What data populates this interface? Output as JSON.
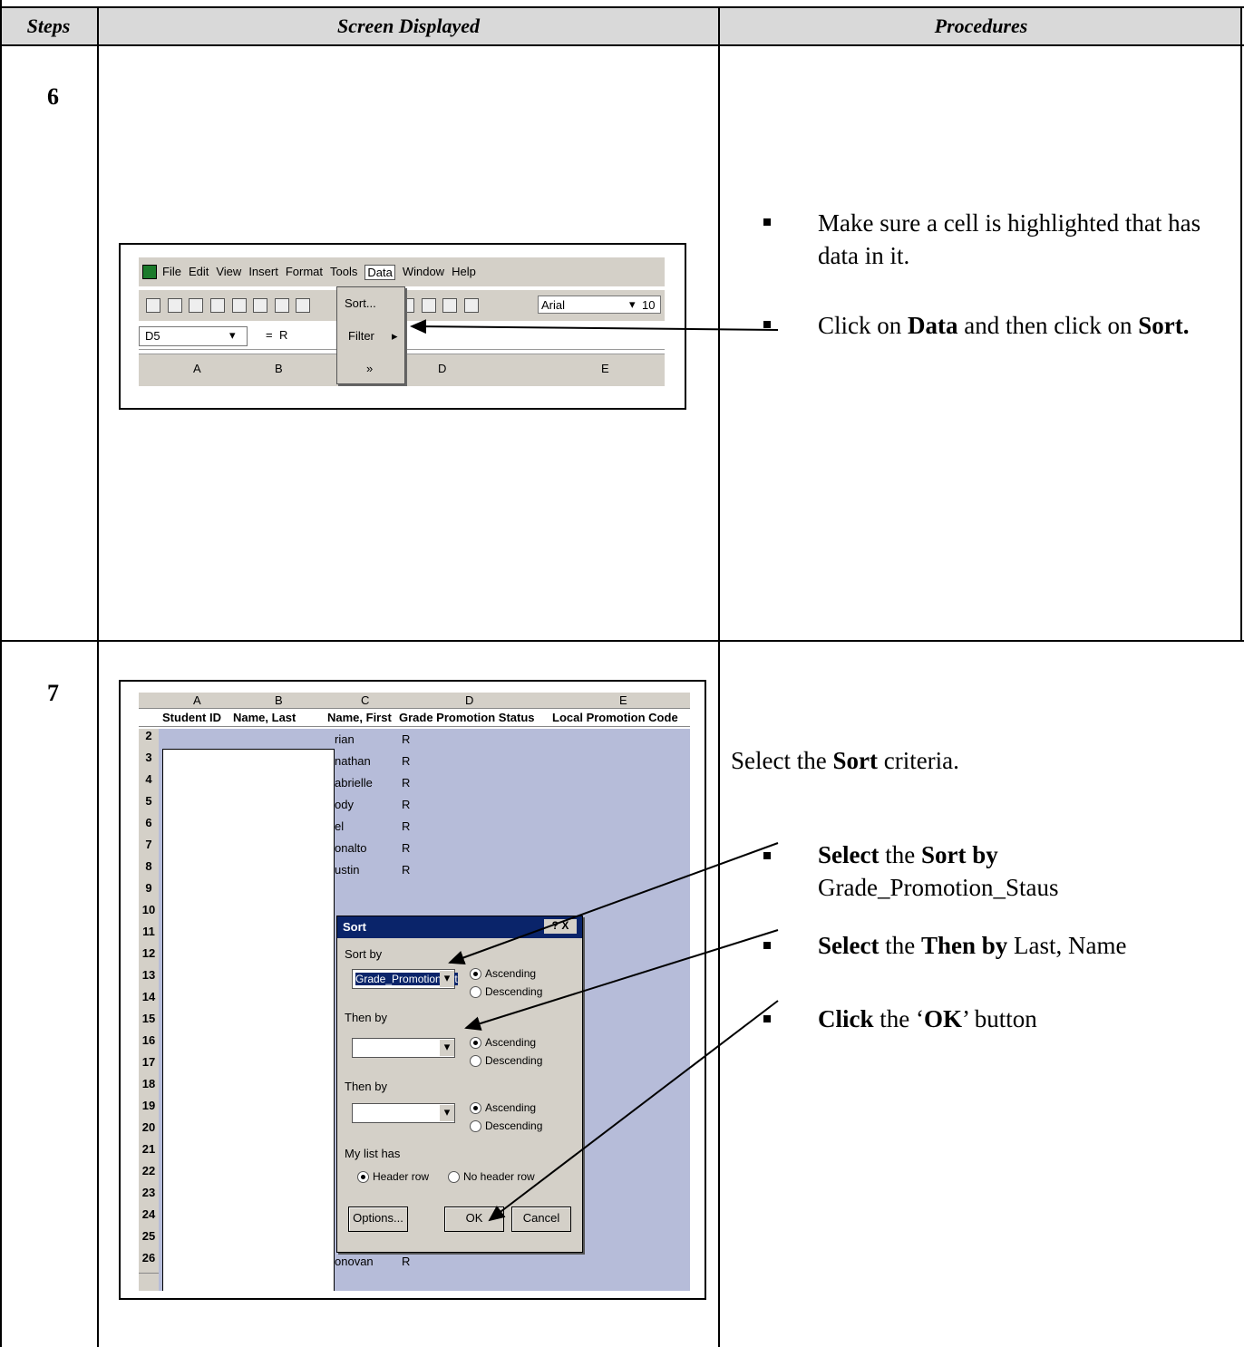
{
  "table": {
    "headers": {
      "steps": "Steps",
      "screen": "Screen Displayed",
      "procedures": "Procedures"
    }
  },
  "step6": {
    "number": "6",
    "menubar": [
      "File",
      "Edit",
      "View",
      "Insert",
      "Format",
      "Tools",
      "Data",
      "Window",
      "Help"
    ],
    "menu_items": [
      "Sort...",
      "Filter",
      "»"
    ],
    "font_box": "Arial",
    "size_box": "10",
    "namebox": "D5",
    "formula": "R",
    "cols": [
      "A",
      "B",
      "D",
      "E"
    ],
    "proc1": "Make sure a cell is highlighted that has data in it.",
    "proc2_pre": "Click on ",
    "proc2_b1": "Data",
    "proc2_mid": " and then click on ",
    "proc2_b2": "Sort."
  },
  "step7": {
    "number": "7",
    "cols": [
      "A",
      "B",
      "C",
      "D",
      "E"
    ],
    "header_row": [
      "Student ID",
      "Name, Last",
      "Name, First",
      "Grade Promotion Status",
      "Local Promotion Code"
    ],
    "firstnames": [
      "rian",
      "nathan",
      "abrielle",
      "ody",
      "el",
      "onalto",
      "ustin"
    ],
    "grade": "R",
    "last_row_first": "onovan",
    "dialog": {
      "title": "Sort",
      "help_close": "? X",
      "sort_by": "Sort by",
      "sort_by_value": "Grade_Promotion_St",
      "then_by1": "Then by",
      "then_by2": "Then by",
      "ascending": "Ascending",
      "descending": "Descending",
      "my_list_has": "My list has",
      "header_row": "Header row",
      "no_header_row": "No header row",
      "options": "Options...",
      "ok": "OK",
      "cancel": "Cancel"
    },
    "intro_pre": "Select the ",
    "intro_b": "Sort",
    "intro_post": " criteria.",
    "p1_b1": "Select",
    "p1_mid": " the ",
    "p1_b2": "Sort by",
    "p1_line2": "Grade_Promotion_Staus",
    "p2_b1": "Select",
    "p2_mid": " the ",
    "p2_b2": "Then by",
    "p2_post": " Last, Name",
    "p3_b1": "Click",
    "p3_mid1": " the ‘",
    "p3_b2": "OK",
    "p3_post": "’ button"
  }
}
